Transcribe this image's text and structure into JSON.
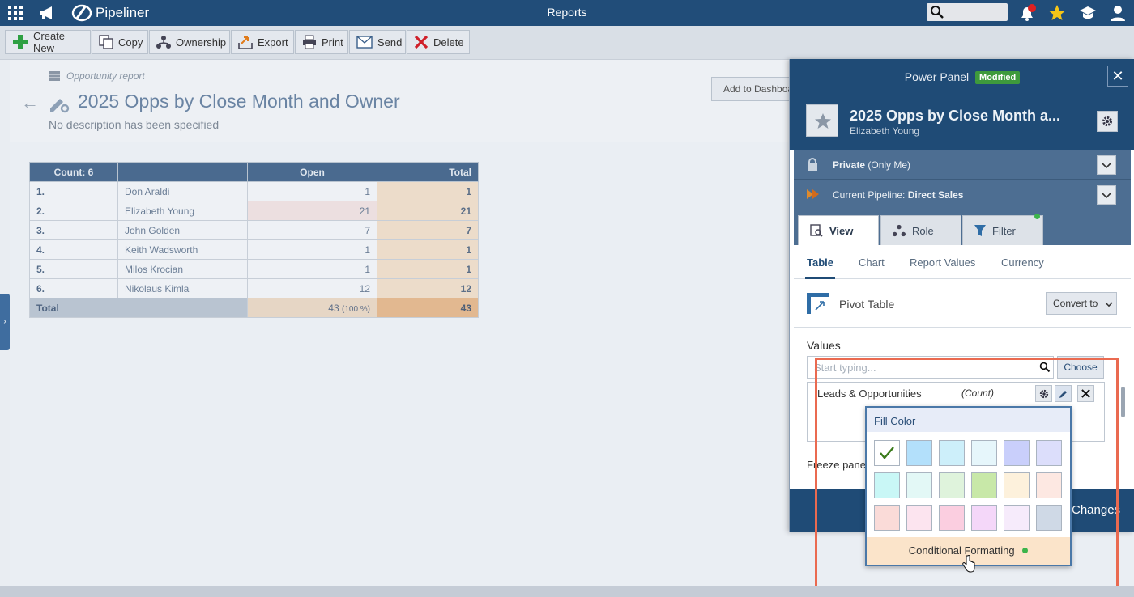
{
  "topbar": {
    "brand": "Pipeliner",
    "title": "Reports"
  },
  "toolbar": {
    "create_new": "Create New",
    "copy": "Copy",
    "ownership": "Ownership",
    "export": "Export",
    "print": "Print",
    "send": "Send",
    "delete": "Delete"
  },
  "report": {
    "type_label": "Opportunity report",
    "title": "2025 Opps by Close Month and Owner",
    "description": "No description has been specified",
    "add_dashboard": "Add to Dashboard"
  },
  "table": {
    "headers": [
      "Count: 6",
      "",
      "Open",
      "Total"
    ],
    "rows": [
      {
        "idx": "1.",
        "name": "Don Araldi",
        "open": "1",
        "total": "1"
      },
      {
        "idx": "2.",
        "name": "Elizabeth Young",
        "open": "21",
        "total": "21"
      },
      {
        "idx": "3.",
        "name": "John Golden",
        "open": "7",
        "total": "7"
      },
      {
        "idx": "4.",
        "name": "Keith Wadsworth",
        "open": "1",
        "total": "1"
      },
      {
        "idx": "5.",
        "name": "Milos Krocian",
        "open": "1",
        "total": "1"
      },
      {
        "idx": "6.",
        "name": "Nikolaus Kimla",
        "open": "12",
        "total": "12"
      }
    ],
    "total_label": "Total",
    "total_open": "43",
    "total_pct": "(100 %)",
    "total_grand": "43"
  },
  "panel": {
    "title": "Power Panel",
    "badge": "Modified",
    "report_name": "2025 Opps by Close Month a...",
    "owner": "Elizabeth Young",
    "privacy_bold": "Private",
    "privacy_rest": " (Only Me)",
    "pipeline_label": "Current Pipeline: ",
    "pipeline_value": "Direct Sales",
    "tabs": [
      "View",
      "Role",
      "Filter"
    ],
    "subtabs": [
      "Table",
      "Chart",
      "Report Values",
      "Currency"
    ],
    "pivot_label": "Pivot Table",
    "convert_label": "Convert to",
    "values_label": "Values",
    "search_placeholder": "Start typing...",
    "choose_label": "Choose",
    "value_item": "Leads & Opportunities",
    "value_agg": "(Count)",
    "freeze_label": "Freeze panes",
    "apply_label": "Changes"
  },
  "fill_popup": {
    "title": "Fill Color",
    "swatches": [
      "#ffffff",
      "#b3e0fb",
      "#cdeffa",
      "#e6f6fb",
      "#c9cffb",
      "#dcdefb",
      "#c9f7f6",
      "#e3f8f6",
      "#dff3dc",
      "#c8e8a8",
      "#fdf1dc",
      "#fde8e2",
      "#fadbd8",
      "#fce4ef",
      "#fbcee0",
      "#f4d7f9",
      "#f6ebfb",
      "#cfd9e6"
    ],
    "conditional_label": "Conditional Formatting"
  }
}
